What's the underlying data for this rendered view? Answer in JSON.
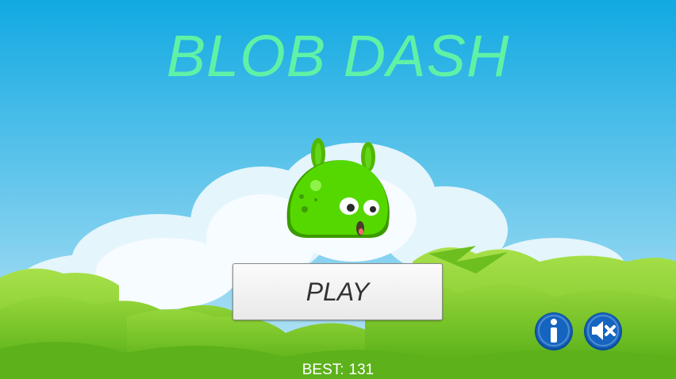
{
  "game": {
    "title": "BLOB DASH"
  },
  "menu": {
    "play_label": "PLAY"
  },
  "stats": {
    "best_label": "BEST:",
    "best_value": "131"
  },
  "icons": {
    "info": "info-icon",
    "mute": "speaker-muted-icon",
    "character": "green-blob"
  },
  "colors": {
    "sky_top": "#11a9e2",
    "sky_bottom": "#bfe6f6",
    "title": "#5ff2a6",
    "blob": "#55d800",
    "foliage": "#7fcf2a",
    "icon_button": "#1565c0"
  }
}
